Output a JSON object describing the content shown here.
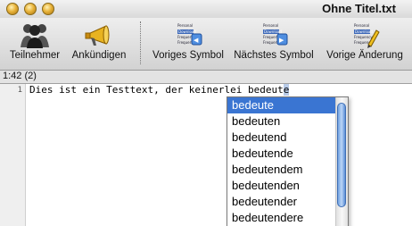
{
  "window": {
    "title": "Ohne Titel.txt"
  },
  "toolbar": {
    "items": [
      {
        "label": "Teilnehmer",
        "icon": "participants-icon"
      },
      {
        "label": "Ankündigen",
        "icon": "megaphone-icon"
      },
      {
        "label": "Voriges Symbol",
        "icon": "previous-symbol-icon"
      },
      {
        "label": "Nächstes Symbol",
        "icon": "next-symbol-icon"
      },
      {
        "label": "Vorige Änderung",
        "icon": "previous-change-icon"
      }
    ],
    "symbol_icon_text": [
      "Personal",
      "Download",
      "Frequency",
      "Frequency"
    ]
  },
  "status": {
    "position": "1:42 (2)"
  },
  "editor": {
    "line_number": "1",
    "text_before": "Dies ist ein Testtext, der keinerlei bedeut",
    "text_selected": "e"
  },
  "autocomplete": {
    "items": [
      "bedeute",
      "bedeuten",
      "bedeutend",
      "bedeutende",
      "bedeutendem",
      "bedeutenden",
      "bedeutender",
      "bedeutendere"
    ],
    "selected_index": 0
  }
}
